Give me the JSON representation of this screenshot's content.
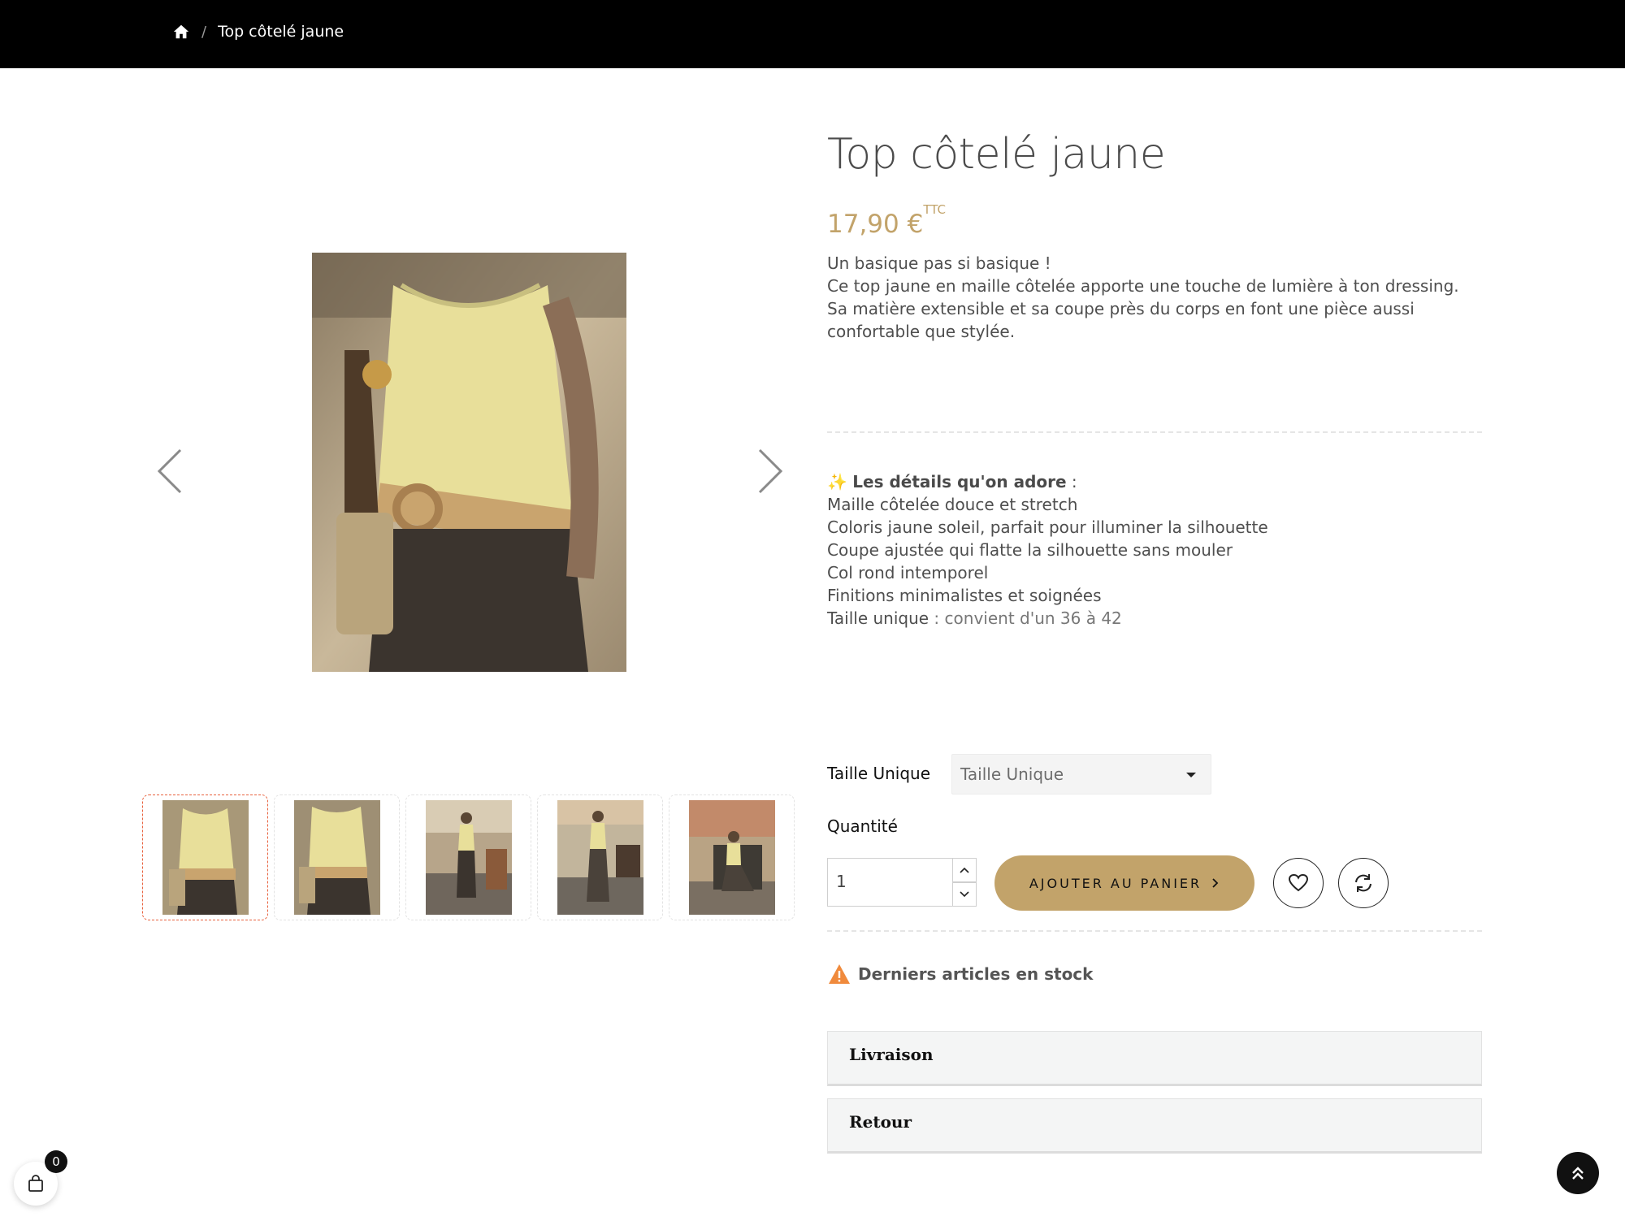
{
  "breadcrumb": {
    "home_icon": "home-icon",
    "separator": "/",
    "current": "Top côtelé jaune"
  },
  "product": {
    "title": "Top côtelé jaune",
    "price": "17,90 €",
    "price_suffix": "TTC",
    "description": [
      "Un basique pas si basique !",
      "Ce top jaune en maille côtelée apporte une touche de lumière à ton dressing.",
      "Sa matière extensible et sa coupe près du corps en font une pièce aussi",
      "confortable que stylée."
    ],
    "details_icon": "✨",
    "details_heading": "Les détails qu'on adore",
    "details_colon": " :",
    "details": [
      "Maille côtelée douce et stretch",
      "Coloris jaune soleil, parfait pour illuminer la silhouette",
      "Coupe ajustée qui flatte la silhouette sans mouler",
      "Col rond intemporel",
      "Finitions minimalistes et soignées"
    ],
    "size_line_label": "Taille unique",
    "size_line_value": " : convient d'un 36 à 42"
  },
  "options": {
    "size_label": "Taille Unique",
    "size_selected": "Taille Unique",
    "quantity_label": "Quantité",
    "quantity_value": "1"
  },
  "actions": {
    "add_to_cart": "AJOUTER AU PANIER",
    "wishlist_icon": "heart-icon",
    "compare_icon": "refresh-icon"
  },
  "stock": {
    "warning_icon": "warning-icon",
    "text": "Derniers articles en stock"
  },
  "accordion": [
    {
      "label": "Livraison"
    },
    {
      "label": "Retour"
    }
  ],
  "cart": {
    "count": "0"
  },
  "gallery": {
    "thumbnail_count": 5,
    "active_index": 0
  },
  "colors": {
    "accent": "#c2a36a",
    "topbar": "#000000",
    "active_thumb_border": "#e8613d",
    "warning": "#f08a3c"
  }
}
